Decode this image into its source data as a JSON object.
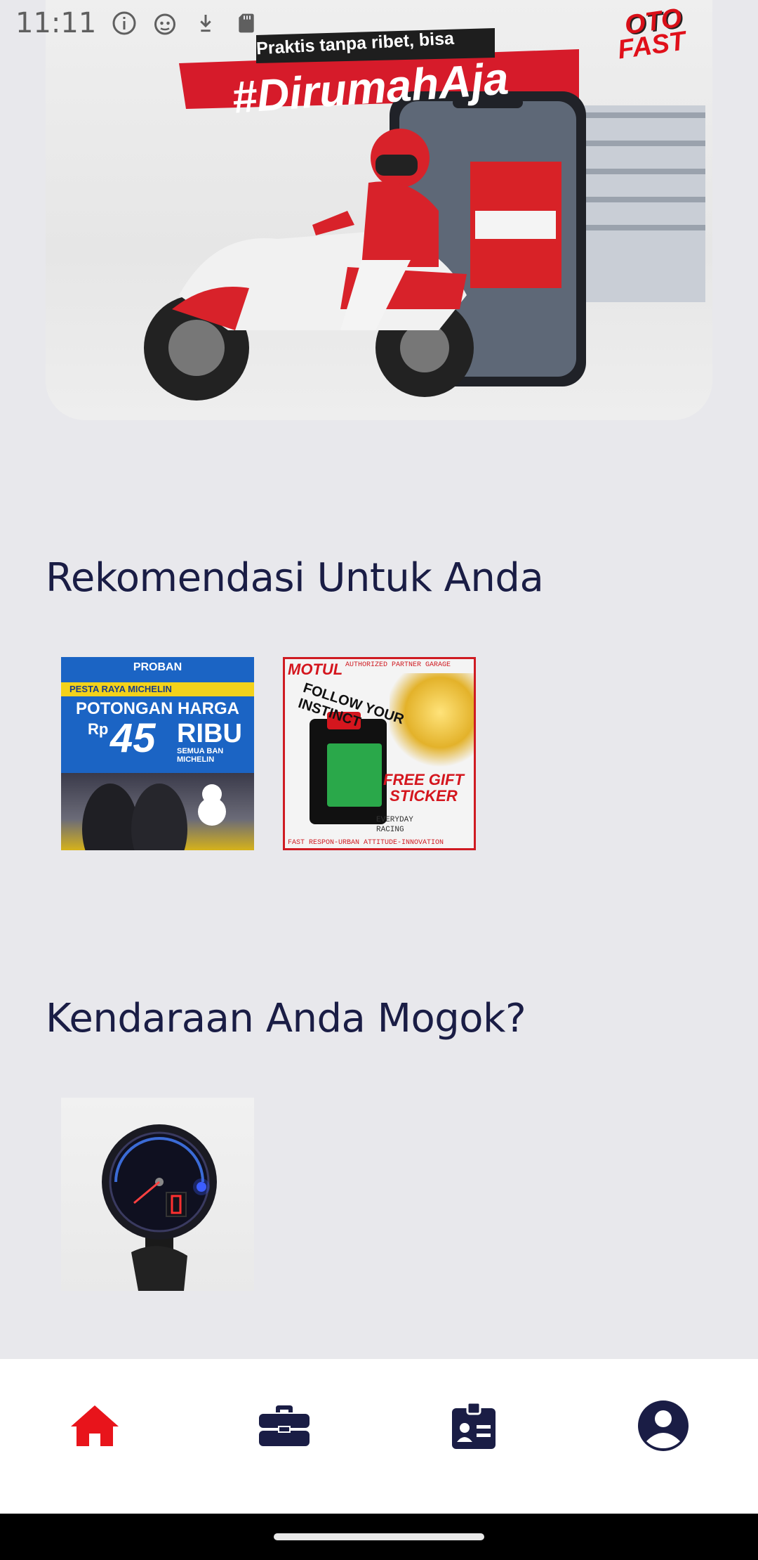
{
  "status_bar": {
    "time": "11:11",
    "icons": [
      "info-icon",
      "android-debug-icon",
      "download-icon",
      "sd-card-icon"
    ]
  },
  "banner": {
    "slogan_top": "Praktis tanpa ribet, bisa",
    "slogan": "#DirumahAja",
    "logo_line1": "OTO",
    "logo_line2": "FAST"
  },
  "sections": {
    "recommendations_title": "Rekomendasi Untuk Anda",
    "breakdown_title": "Kendaraan Anda Mogok?"
  },
  "promo_michelin": {
    "brand": "PROBAN",
    "event": "PESTA RAYA MICHELIN",
    "headline": "POTONGAN HARGA",
    "currency": "Rp",
    "amount": "45",
    "unit": "RIBU",
    "subtitle": "SEMUA BAN MICHELIN"
  },
  "promo_motul": {
    "brand": "MOTUL",
    "partner": "AUTHORIZED PARTNER GARAGE",
    "tagline": "FOLLOW YOUR INSTINCT",
    "gift_line1": "FREE GIFT",
    "gift_line2": "STICKER",
    "everyday": "EVERYDAY",
    "racing": "RACING",
    "footer": "FAST RESPON-URBAN ATTITUDE-INNOVATION"
  },
  "bottom_nav": {
    "items": [
      "home-icon",
      "briefcase-icon",
      "id-card-icon",
      "account-icon"
    ],
    "active_color": "#e8141b",
    "inactive_color": "#1a1d45"
  }
}
